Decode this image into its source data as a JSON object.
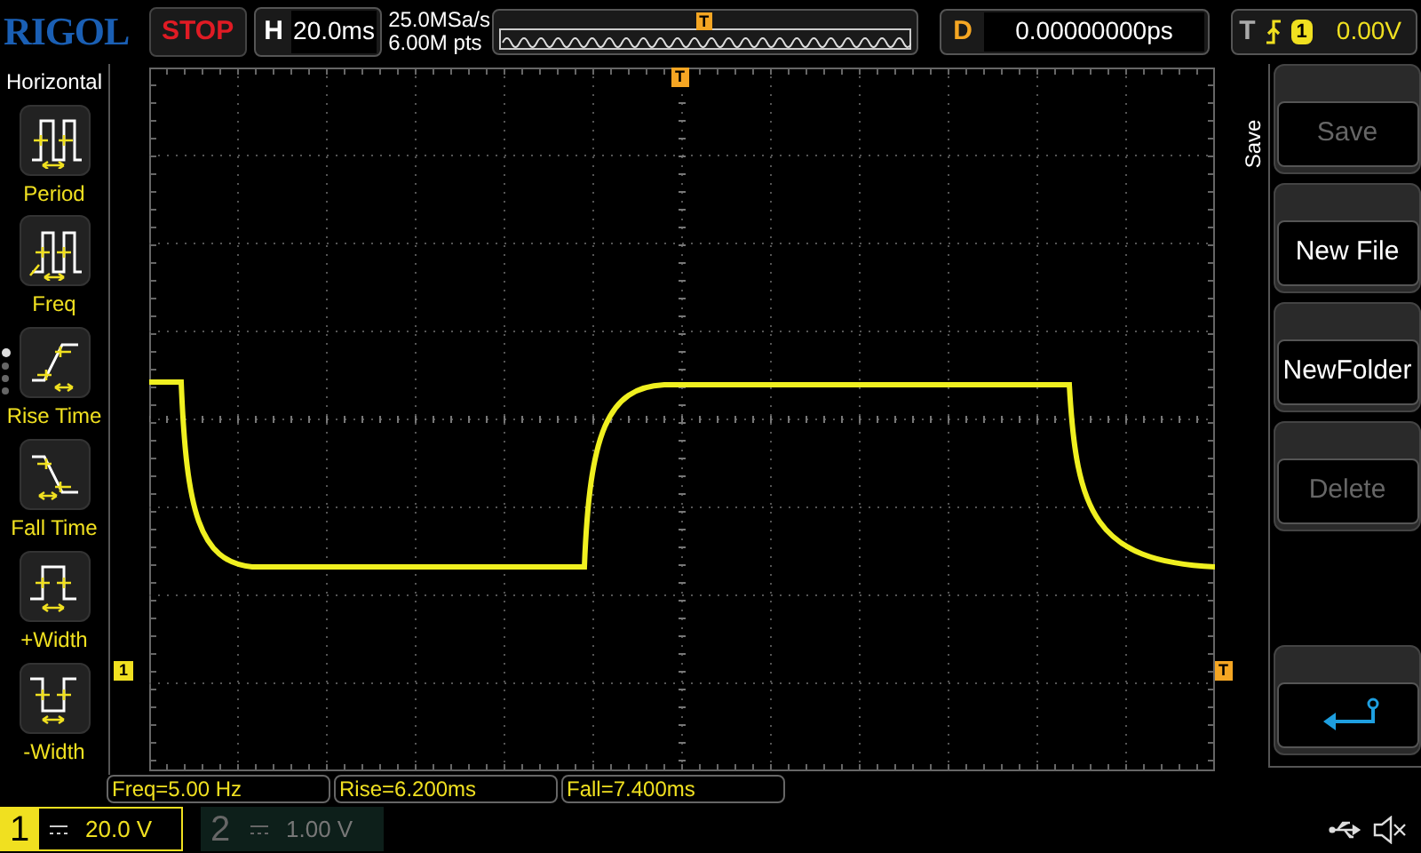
{
  "top_bar": {
    "logo": "RIGOL",
    "run_state": "STOP",
    "timebase": {
      "label": "H",
      "value": "20.0ms"
    },
    "sample_rate": "25.0MSa/s",
    "memory_depth": "6.00M pts",
    "trigger_position_marker": "T",
    "delay": {
      "label": "D",
      "value": "0.00000000ps"
    },
    "trigger": {
      "label": "T",
      "source": "1",
      "level": "0.00V"
    }
  },
  "left_menu": {
    "title": "Horizontal",
    "items": [
      {
        "kind": "period",
        "label": "Period"
      },
      {
        "kind": "freq",
        "label": "Freq"
      },
      {
        "kind": "rise",
        "label": "Rise Time"
      },
      {
        "kind": "fall",
        "label": "Fall Time"
      },
      {
        "kind": "pwidth",
        "label": "+Width"
      },
      {
        "kind": "nwidth",
        "label": "-Width"
      }
    ],
    "page_dots": [
      {
        "selected": true
      },
      {
        "selected": false
      },
      {
        "selected": false
      },
      {
        "selected": false
      }
    ]
  },
  "waveform_area": {
    "trigger_marker": "T",
    "channel_marker": "1",
    "trigger_level_marker": "T"
  },
  "right_menu": {
    "title": "Save",
    "buttons": [
      {
        "kind": "text",
        "label": "Save",
        "disabled": true
      },
      {
        "kind": "text",
        "label": "New File",
        "disabled": false
      },
      {
        "kind": "text",
        "label": "NewFolder",
        "disabled": false
      },
      {
        "kind": "text",
        "label": "Delete",
        "disabled": true
      },
      {
        "kind": "back"
      }
    ]
  },
  "measurements": [
    "Freq=5.00 Hz",
    "Rise=6.200ms",
    "Fall=7.400ms"
  ],
  "channels": [
    {
      "label": "1",
      "scale": "20.0 V",
      "selected": true
    },
    {
      "label": "2",
      "scale": "1.00 V",
      "selected": false
    }
  ]
}
